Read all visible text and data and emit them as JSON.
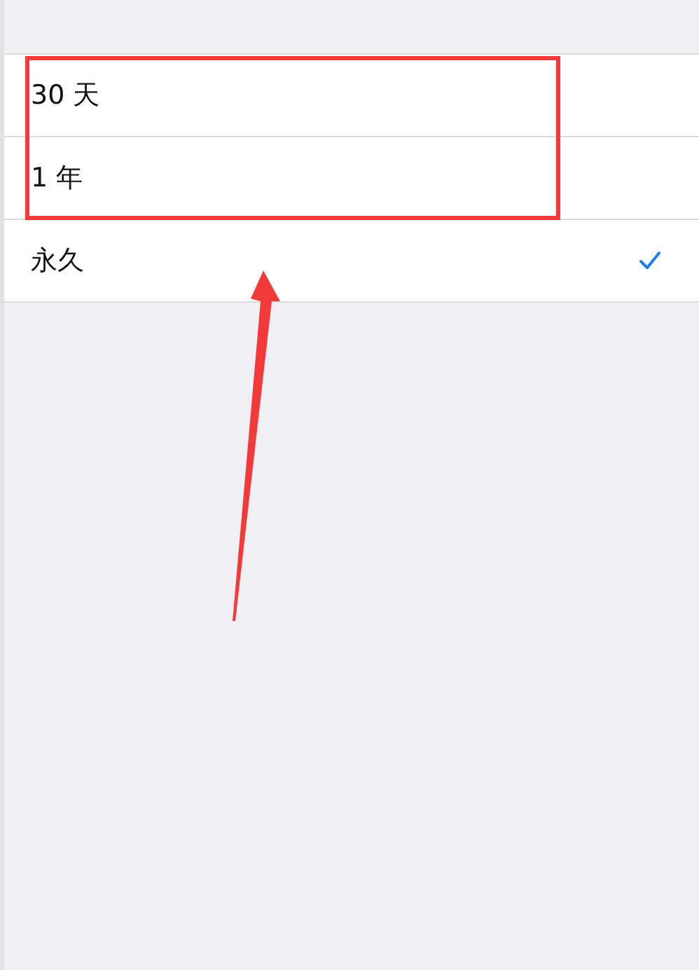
{
  "options": [
    {
      "label": "30 天",
      "selected": false
    },
    {
      "label": "1 年",
      "selected": false
    },
    {
      "label": "永久",
      "selected": true
    }
  ]
}
